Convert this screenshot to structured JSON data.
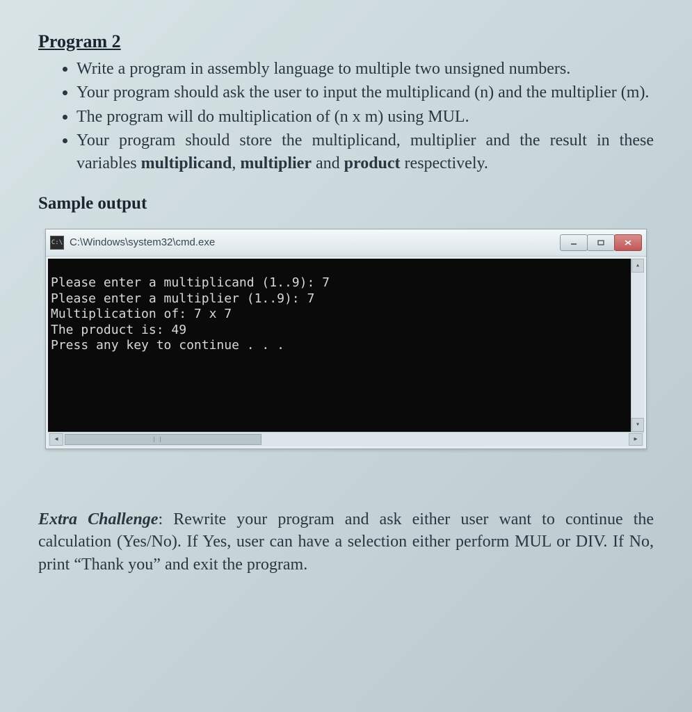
{
  "title": "Program 2",
  "bullets": [
    "Write a program in assembly language to multiple two unsigned numbers.",
    "Your program should ask the user to input the multiplicand (n) and the multiplier (m).",
    "The program will do multiplication of (n x m) using MUL.",
    "Your program should store the multiplicand, multiplier and the result in these variables multiplicand, multiplier and product respectively."
  ],
  "bullet4_prefix": "Your program should store the multiplicand, multiplier and the result in these variables ",
  "bullet4_b1": "multiplicand",
  "bullet4_sep1": ", ",
  "bullet4_b2": "multiplier",
  "bullet4_sep2": " and ",
  "bullet4_b3": "product",
  "bullet4_suffix": " respectively.",
  "sample_heading": "Sample output",
  "console": {
    "icon_label": "C:\\",
    "title": "C:\\Windows\\system32\\cmd.exe",
    "lines": [
      "Please enter a multiplicand (1..9): 7",
      "Please enter a multiplier (1..9): 7",
      "Multiplication of: 7 x 7",
      "The product is: 49",
      "Press any key to continue . . ."
    ]
  },
  "extra": {
    "label": "Extra Challenge",
    "text": ": Rewrite your program and ask either user want to continue the calculation (Yes/No). If Yes, user can have a selection either perform MUL or DIV. If No, print “Thank you” and exit the program."
  }
}
